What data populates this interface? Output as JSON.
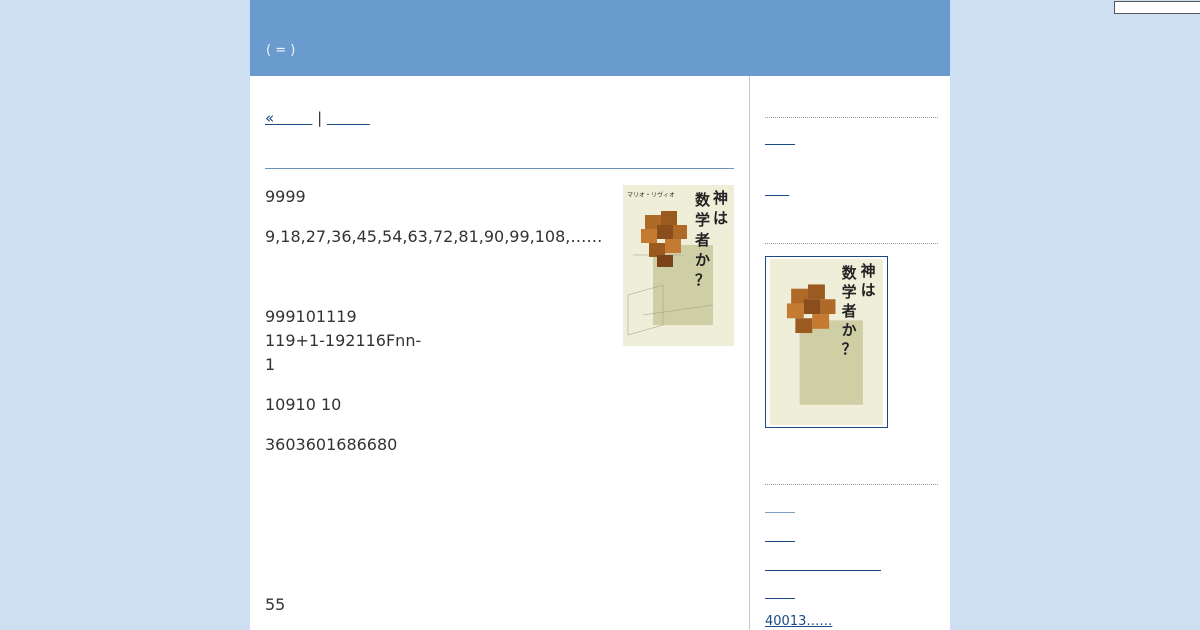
{
  "header": {
    "subtitle": "( = )"
  },
  "nav": {
    "prev_label": "«",
    "separator": "|"
  },
  "article": {
    "p1": "9999",
    "p2": "9,18,27,36,45,54,63,72,81,90,99,108,……",
    "p3_line1": "999101119",
    "p3_line2": "119+1-192116Fnn-",
    "p3_line3": "1",
    "p4": "10910 10",
    "p5": "3603601686680",
    "p6": "55"
  },
  "book": {
    "title_chars": [
      "神",
      "は",
      "数",
      "学",
      "者",
      "か",
      "？"
    ],
    "author": "マリオ・リヴィオ",
    "colors": {
      "cover": "#efeed8",
      "accent": "#c7c79a",
      "wood": "#9a5a20"
    }
  },
  "sidebar": {
    "section1_title": "",
    "section2_title": "",
    "section3_title": "",
    "link_text": "40013……"
  }
}
